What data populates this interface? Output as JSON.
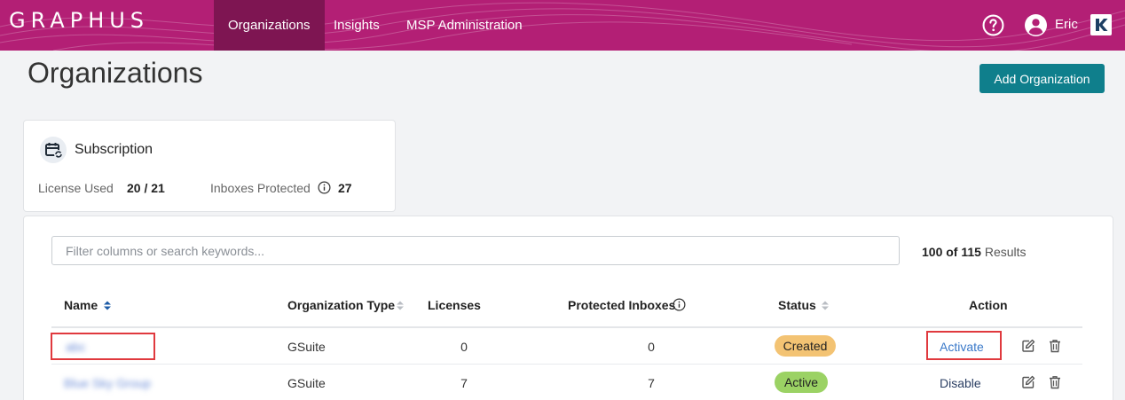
{
  "nav": {
    "logo": "GRAPHUS",
    "tabs": [
      {
        "label": "Organizations",
        "active": true
      },
      {
        "label": "Insights",
        "active": false
      },
      {
        "label": "MSP Administration",
        "active": false
      }
    ],
    "user": "Eric",
    "icons": [
      "help-icon",
      "user-icon",
      "brand-badge-icon"
    ],
    "colors": {
      "bar": "#b31f75",
      "active_tab": "#7e1552"
    }
  },
  "page": {
    "title": "Organizations",
    "add_button": "Add Organization"
  },
  "subscription": {
    "title": "Subscription",
    "license_label": "License Used",
    "license_value": "20 / 21",
    "inboxes_label": "Inboxes Protected",
    "inboxes_value": "27"
  },
  "table": {
    "search_placeholder": "Filter columns or search keywords...",
    "results_count": "100 of 115",
    "results_label": "Results",
    "columns": [
      "Name",
      "Organization Type",
      "Licenses",
      "Protected Inboxes",
      "Status",
      "Action"
    ],
    "rows": [
      {
        "name": "abc",
        "type": "GSuite",
        "licenses": "0",
        "protected": "0",
        "status": "Created",
        "action": "Activate"
      },
      {
        "name": "Blue Sky Group",
        "type": "GSuite",
        "licenses": "7",
        "protected": "7",
        "status": "Active",
        "action": "Disable"
      }
    ]
  }
}
